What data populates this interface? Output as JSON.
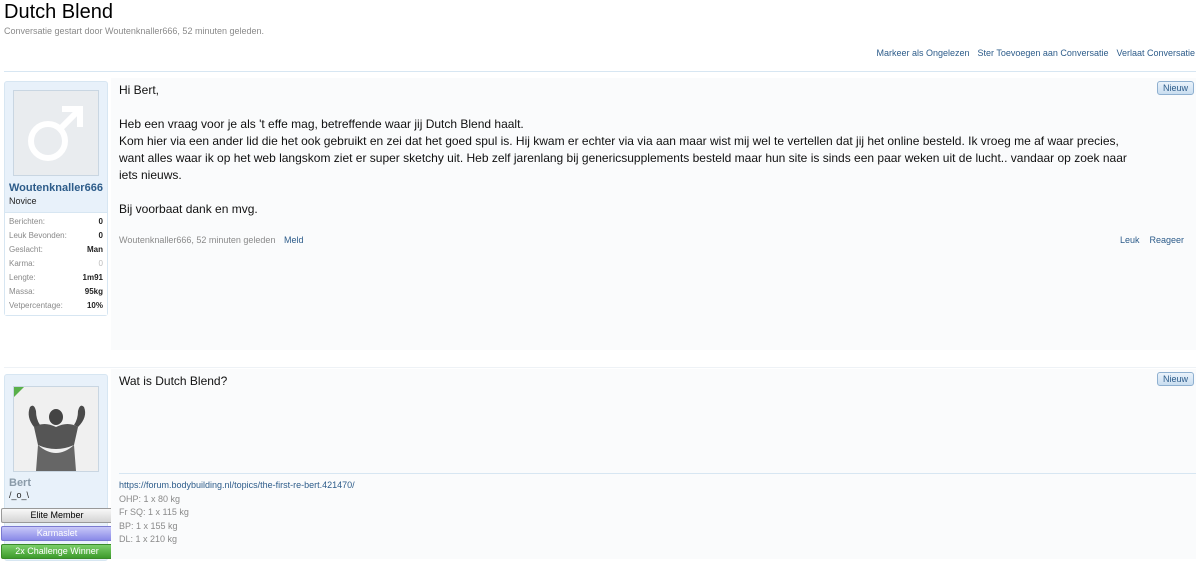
{
  "thread": {
    "title": "Dutch Blend",
    "subtitle": "Conversatie gestart door Woutenknaller666, 52 minuten geleden."
  },
  "actions": [
    "Markeer als Ongelezen",
    "Ster Toevoegen aan Conversatie",
    "Verlaat Conversatie"
  ],
  "messages": [
    {
      "user": {
        "name": "Woutenknaller666",
        "title": "Novice",
        "avatar_icon": "male-symbol-icon",
        "stats": [
          {
            "k": "Berichten:",
            "v": "0"
          },
          {
            "k": "Leuk Bevonden:",
            "v": "0"
          },
          {
            "k": "Geslacht:",
            "v": "Man"
          },
          {
            "k": "Karma:",
            "v": "0"
          },
          {
            "k": "Lengte:",
            "v": "1m91"
          },
          {
            "k": "Massa:",
            "v": "95kg"
          },
          {
            "k": "Vetpercentage:",
            "v": "10%"
          }
        ]
      },
      "badge": "Nieuw",
      "paragraphs": [
        "Hi Bert,",
        "Heb een vraag voor je als 't effe mag, betreffende waar jij Dutch Blend haalt.\nKom hier via een ander lid die het ook gebruikt en zei dat het goed spul is. Hij kwam er echter via via aan maar wist mij wel te vertellen dat jij het online besteld. Ik vroeg me af waar precies, want alles waar ik op het web langskom ziet er super sketchy uit. Heb zelf jarenlang bij genericsupplements besteld maar hun site is sinds een paar weken uit de lucht.. vandaar op zoek naar iets nieuws.",
        "Bij voorbaat dank en mvg."
      ],
      "meta": "Woutenknaller666, 52 minuten geleden",
      "report": "Meld",
      "controls": [
        "Leuk",
        "Reageer"
      ]
    },
    {
      "user": {
        "name": "Bert",
        "title": "/_o_\\",
        "avatar_icon": "bodybuilder-photo",
        "ribbons": [
          "Elite Member",
          "Karmaslet",
          "2x Challenge Winner"
        ]
      },
      "badge": "Nieuw",
      "paragraphs": [
        "Wat is Dutch Blend?"
      ],
      "signature": {
        "link": "https://forum.bodybuilding.nl/topics/the-first-re-bert.421470/",
        "lines": [
          "OHP: 1 x 80 kg",
          "Fr SQ: 1 x 115 kg",
          "BP: 1 x 155 kg",
          "DL: 1 x 210 kg"
        ]
      }
    }
  ]
}
